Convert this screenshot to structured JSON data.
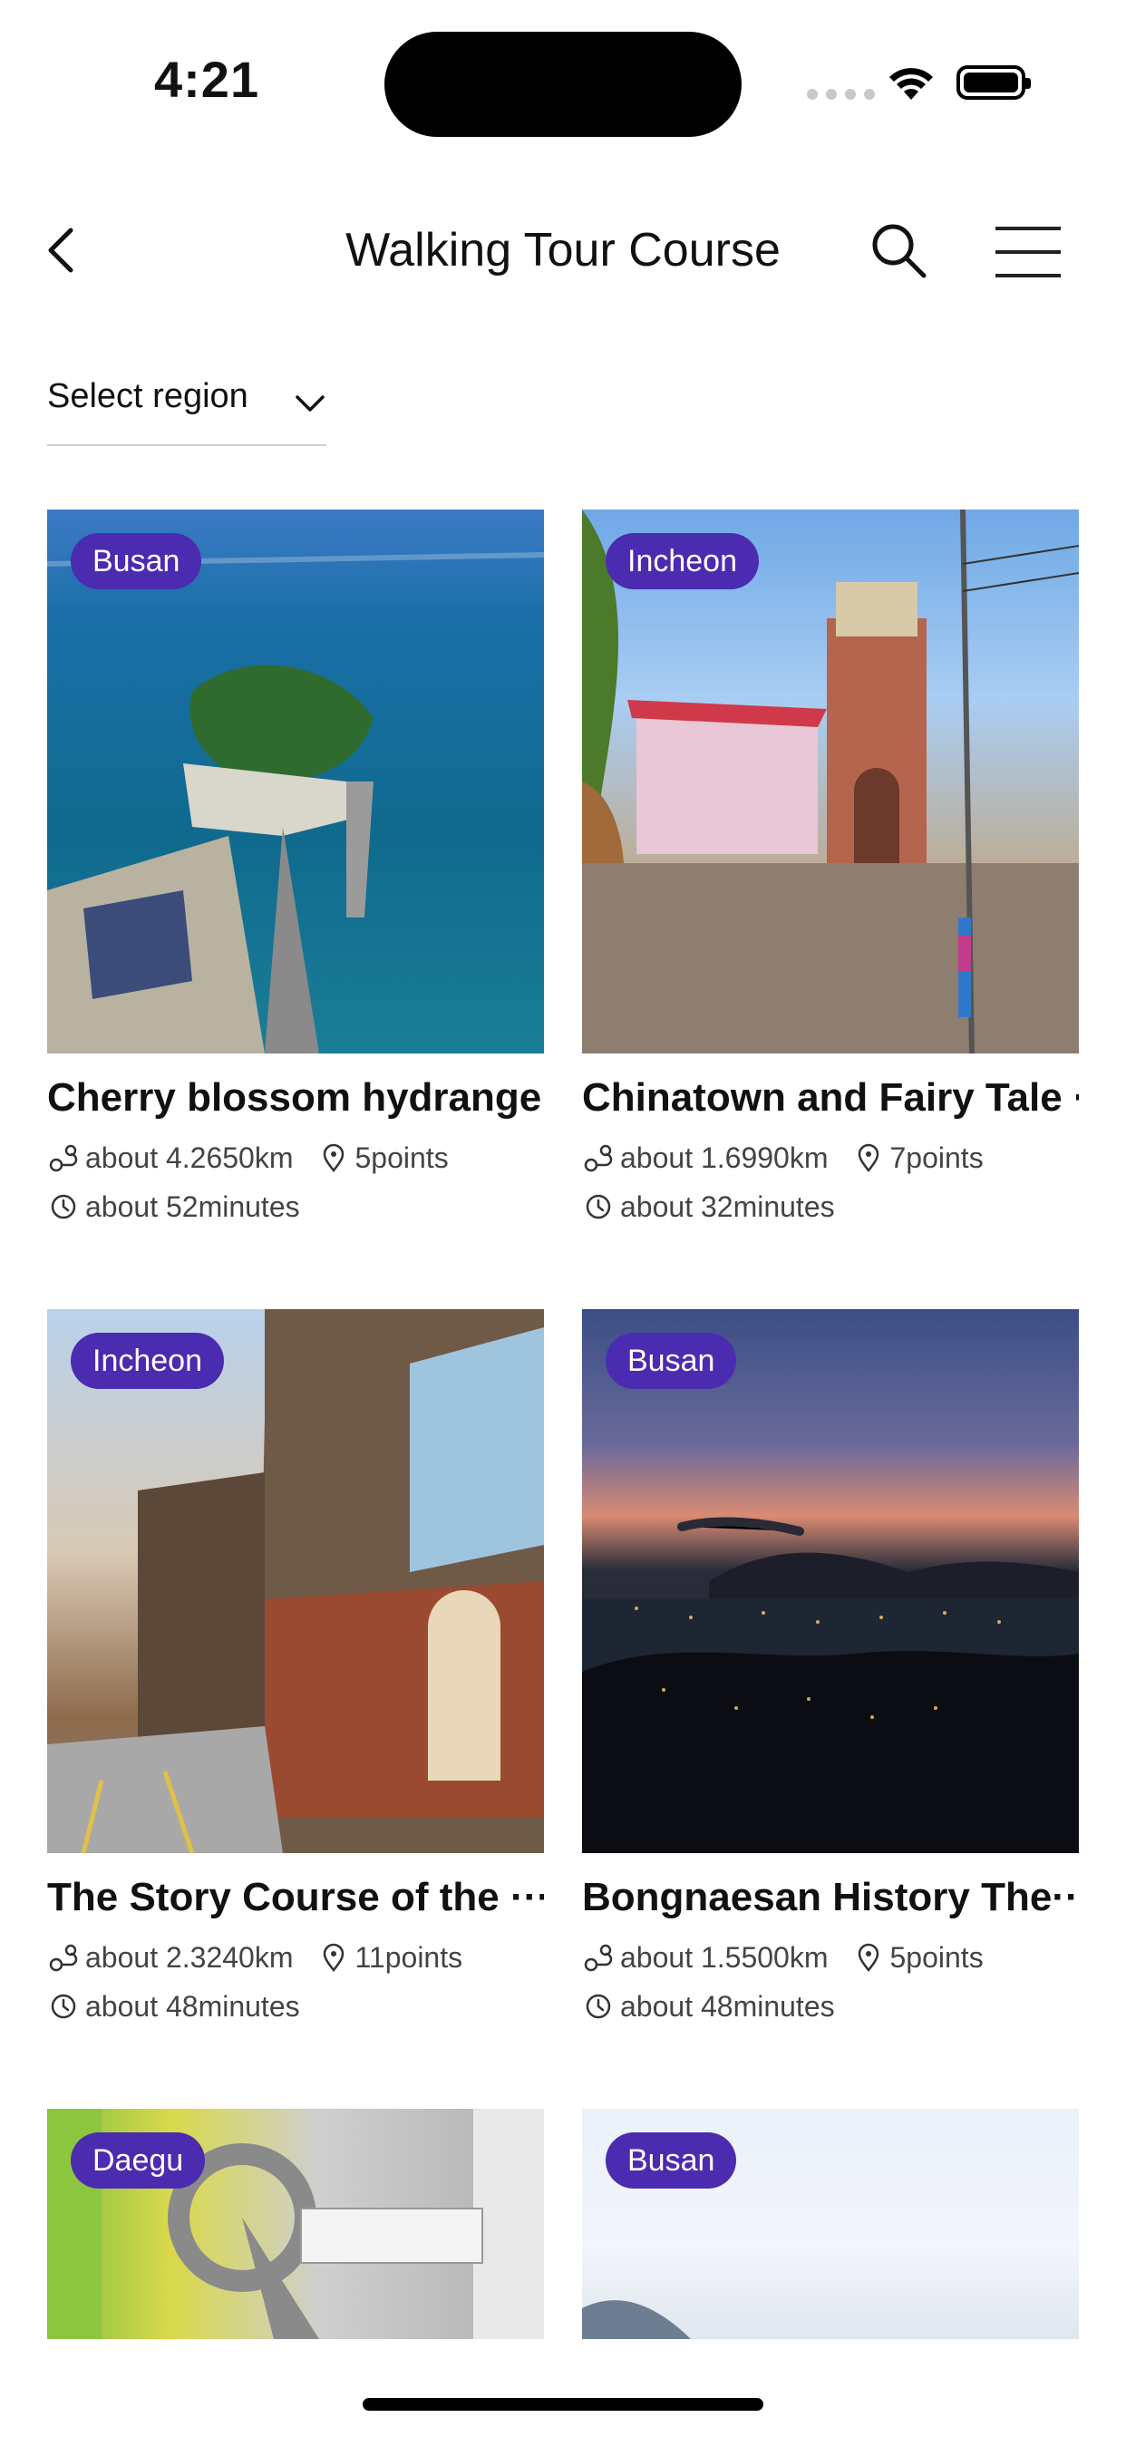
{
  "status": {
    "time": "4:21"
  },
  "nav": {
    "title": "Walking Tour Course"
  },
  "region": {
    "label": "Select region"
  },
  "cards": [
    {
      "badge": "Busan",
      "title": "Cherry blossom hydrange···",
      "distance": "about 4.2650km",
      "points": "5points",
      "duration": "about 52minutes"
    },
    {
      "badge": "Incheon",
      "title": "Chinatown and Fairy Tale ···",
      "distance": "about 1.6990km",
      "points": "7points",
      "duration": "about 32minutes"
    },
    {
      "badge": "Incheon",
      "title": "The Story Course of the ···",
      "distance": "about 2.3240km",
      "points": "11points",
      "duration": "about 48minutes"
    },
    {
      "badge": "Busan",
      "title": "Bongnaesan History The···",
      "distance": "about 1.5500km",
      "points": "5points",
      "duration": "about 48minutes"
    },
    {
      "badge": "Daegu"
    },
    {
      "badge": "Busan"
    }
  ],
  "colors": {
    "badge": "#4b2bb0",
    "text": "#111111",
    "meta": "#444444"
  }
}
